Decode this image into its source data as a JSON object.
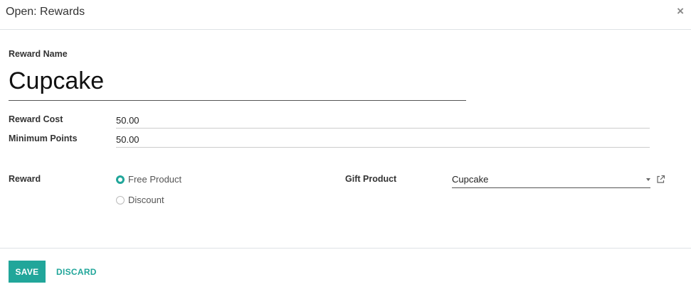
{
  "dialog": {
    "title": "Open: Rewards",
    "close_label": "×"
  },
  "form": {
    "reward_name_label": "Reward Name",
    "reward_name_value": "Cupcake",
    "reward_cost_label": "Reward Cost",
    "reward_cost_value": "50.00",
    "minimum_points_label": "Minimum Points",
    "minimum_points_value": "50.00",
    "reward_label": "Reward",
    "reward_options": [
      {
        "label": "Free Product",
        "checked": true
      },
      {
        "label": "Discount",
        "checked": false
      }
    ],
    "gift_product_label": "Gift Product",
    "gift_product_value": "Cupcake"
  },
  "footer": {
    "save_label": "SAVE",
    "discard_label": "DISCARD"
  },
  "colors": {
    "accent": "#21a69a"
  }
}
